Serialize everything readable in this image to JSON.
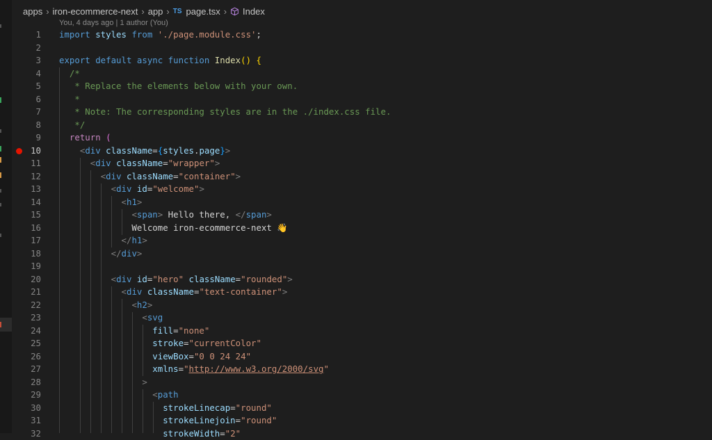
{
  "breadcrumb": {
    "items": [
      "apps",
      "iron-ecommerce-next",
      "app",
      "page.tsx",
      "Index"
    ],
    "file_icon_text": "TS"
  },
  "blame": "You, 4 days ago | 1 author (You)",
  "breakpoint_line": 10,
  "active_line": 10,
  "lines": [
    {
      "n": "1",
      "tokens": [
        [
          "kw",
          "import "
        ],
        [
          "var",
          "styles "
        ],
        [
          "kw",
          "from "
        ],
        [
          "str",
          "'./page.module.css'"
        ],
        [
          "txt",
          ";"
        ]
      ]
    },
    {
      "n": "2",
      "tokens": []
    },
    {
      "n": "3",
      "tokens": [
        [
          "kw",
          "export default async function "
        ],
        [
          "fn",
          "Index"
        ],
        [
          "brk1",
          "() {"
        ]
      ]
    },
    {
      "n": "4",
      "tokens": [
        [
          "cm",
          "  /*"
        ]
      ]
    },
    {
      "n": "5",
      "tokens": [
        [
          "cm",
          "   * Replace the elements below with your own."
        ]
      ]
    },
    {
      "n": "6",
      "tokens": [
        [
          "cm",
          "   *"
        ]
      ]
    },
    {
      "n": "7",
      "tokens": [
        [
          "cm",
          "   * Note: The corresponding styles are in the ./index.css file."
        ]
      ]
    },
    {
      "n": "8",
      "tokens": [
        [
          "cm",
          "   */"
        ]
      ]
    },
    {
      "n": "9",
      "tokens": [
        [
          "txt",
          "  "
        ],
        [
          "ctl",
          "return "
        ],
        [
          "brk2",
          "("
        ]
      ]
    },
    {
      "n": "10",
      "tokens": [
        [
          "txt",
          "    "
        ],
        [
          "punc",
          "<"
        ],
        [
          "tag",
          "div "
        ],
        [
          "attr",
          "className"
        ],
        [
          "txt",
          "="
        ],
        [
          "brk3",
          "{"
        ],
        [
          "var",
          "styles"
        ],
        [
          "txt",
          "."
        ],
        [
          "var",
          "page"
        ],
        [
          "brk3",
          "}"
        ],
        [
          "punc",
          ">"
        ]
      ]
    },
    {
      "n": "11",
      "tokens": [
        [
          "txt",
          "      "
        ],
        [
          "punc",
          "<"
        ],
        [
          "tag",
          "div "
        ],
        [
          "attr",
          "className"
        ],
        [
          "txt",
          "="
        ],
        [
          "str",
          "\"wrapper\""
        ],
        [
          "punc",
          ">"
        ]
      ]
    },
    {
      "n": "12",
      "tokens": [
        [
          "txt",
          "        "
        ],
        [
          "punc",
          "<"
        ],
        [
          "tag",
          "div "
        ],
        [
          "attr",
          "className"
        ],
        [
          "txt",
          "="
        ],
        [
          "str",
          "\"container\""
        ],
        [
          "punc",
          ">"
        ]
      ]
    },
    {
      "n": "13",
      "tokens": [
        [
          "txt",
          "          "
        ],
        [
          "punc",
          "<"
        ],
        [
          "tag",
          "div "
        ],
        [
          "attr",
          "id"
        ],
        [
          "txt",
          "="
        ],
        [
          "str",
          "\"welcome\""
        ],
        [
          "punc",
          ">"
        ]
      ]
    },
    {
      "n": "14",
      "tokens": [
        [
          "txt",
          "            "
        ],
        [
          "punc",
          "<"
        ],
        [
          "tag",
          "h1"
        ],
        [
          "punc",
          ">"
        ]
      ]
    },
    {
      "n": "15",
      "tokens": [
        [
          "txt",
          "              "
        ],
        [
          "punc",
          "<"
        ],
        [
          "tag",
          "span"
        ],
        [
          "punc",
          "> "
        ],
        [
          "txt",
          "Hello there, "
        ],
        [
          "punc",
          "</"
        ],
        [
          "tag",
          "span"
        ],
        [
          "punc",
          ">"
        ]
      ]
    },
    {
      "n": "16",
      "tokens": [
        [
          "txt",
          "              Welcome iron-ecommerce-next "
        ],
        [
          "emoji",
          "👋"
        ]
      ]
    },
    {
      "n": "17",
      "tokens": [
        [
          "txt",
          "            "
        ],
        [
          "punc",
          "</"
        ],
        [
          "tag",
          "h1"
        ],
        [
          "punc",
          ">"
        ]
      ]
    },
    {
      "n": "18",
      "tokens": [
        [
          "txt",
          "          "
        ],
        [
          "punc",
          "</"
        ],
        [
          "tag",
          "div"
        ],
        [
          "punc",
          ">"
        ]
      ]
    },
    {
      "n": "19",
      "tokens": []
    },
    {
      "n": "20",
      "tokens": [
        [
          "txt",
          "          "
        ],
        [
          "punc",
          "<"
        ],
        [
          "tag",
          "div "
        ],
        [
          "attr",
          "id"
        ],
        [
          "txt",
          "="
        ],
        [
          "str",
          "\"hero\" "
        ],
        [
          "attr",
          "className"
        ],
        [
          "txt",
          "="
        ],
        [
          "str",
          "\"rounded\""
        ],
        [
          "punc",
          ">"
        ]
      ]
    },
    {
      "n": "21",
      "tokens": [
        [
          "txt",
          "            "
        ],
        [
          "punc",
          "<"
        ],
        [
          "tag",
          "div "
        ],
        [
          "attr",
          "className"
        ],
        [
          "txt",
          "="
        ],
        [
          "str",
          "\"text-container\""
        ],
        [
          "punc",
          ">"
        ]
      ]
    },
    {
      "n": "22",
      "tokens": [
        [
          "txt",
          "              "
        ],
        [
          "punc",
          "<"
        ],
        [
          "tag",
          "h2"
        ],
        [
          "punc",
          ">"
        ]
      ]
    },
    {
      "n": "23",
      "tokens": [
        [
          "txt",
          "                "
        ],
        [
          "punc",
          "<"
        ],
        [
          "tag",
          "svg"
        ]
      ]
    },
    {
      "n": "24",
      "tokens": [
        [
          "txt",
          "                  "
        ],
        [
          "attr",
          "fill"
        ],
        [
          "txt",
          "="
        ],
        [
          "str",
          "\"none\""
        ]
      ]
    },
    {
      "n": "25",
      "tokens": [
        [
          "txt",
          "                  "
        ],
        [
          "attr",
          "stroke"
        ],
        [
          "txt",
          "="
        ],
        [
          "str",
          "\"currentColor\""
        ]
      ]
    },
    {
      "n": "26",
      "tokens": [
        [
          "txt",
          "                  "
        ],
        [
          "attr",
          "viewBox"
        ],
        [
          "txt",
          "="
        ],
        [
          "str",
          "\"0 0 24 24\""
        ]
      ]
    },
    {
      "n": "27",
      "tokens": [
        [
          "txt",
          "                  "
        ],
        [
          "attr",
          "xmlns"
        ],
        [
          "txt",
          "="
        ],
        [
          "str",
          "\""
        ],
        [
          "link",
          "http://www.w3.org/2000/svg"
        ],
        [
          "str",
          "\""
        ]
      ]
    },
    {
      "n": "28",
      "tokens": [
        [
          "txt",
          "                "
        ],
        [
          "punc",
          ">"
        ]
      ]
    },
    {
      "n": "29",
      "tokens": [
        [
          "txt",
          "                  "
        ],
        [
          "punc",
          "<"
        ],
        [
          "tag",
          "path"
        ]
      ]
    },
    {
      "n": "30",
      "tokens": [
        [
          "txt",
          "                    "
        ],
        [
          "attr",
          "strokeLinecap"
        ],
        [
          "txt",
          "="
        ],
        [
          "str",
          "\"round\""
        ]
      ]
    },
    {
      "n": "31",
      "tokens": [
        [
          "txt",
          "                    "
        ],
        [
          "attr",
          "strokeLinejoin"
        ],
        [
          "txt",
          "="
        ],
        [
          "str",
          "\"round\""
        ]
      ]
    },
    {
      "n": "32",
      "tokens": [
        [
          "txt",
          "                    "
        ],
        [
          "attr",
          "strokeWidth"
        ],
        [
          "txt",
          "="
        ],
        [
          "str",
          "\"2\""
        ]
      ]
    }
  ]
}
